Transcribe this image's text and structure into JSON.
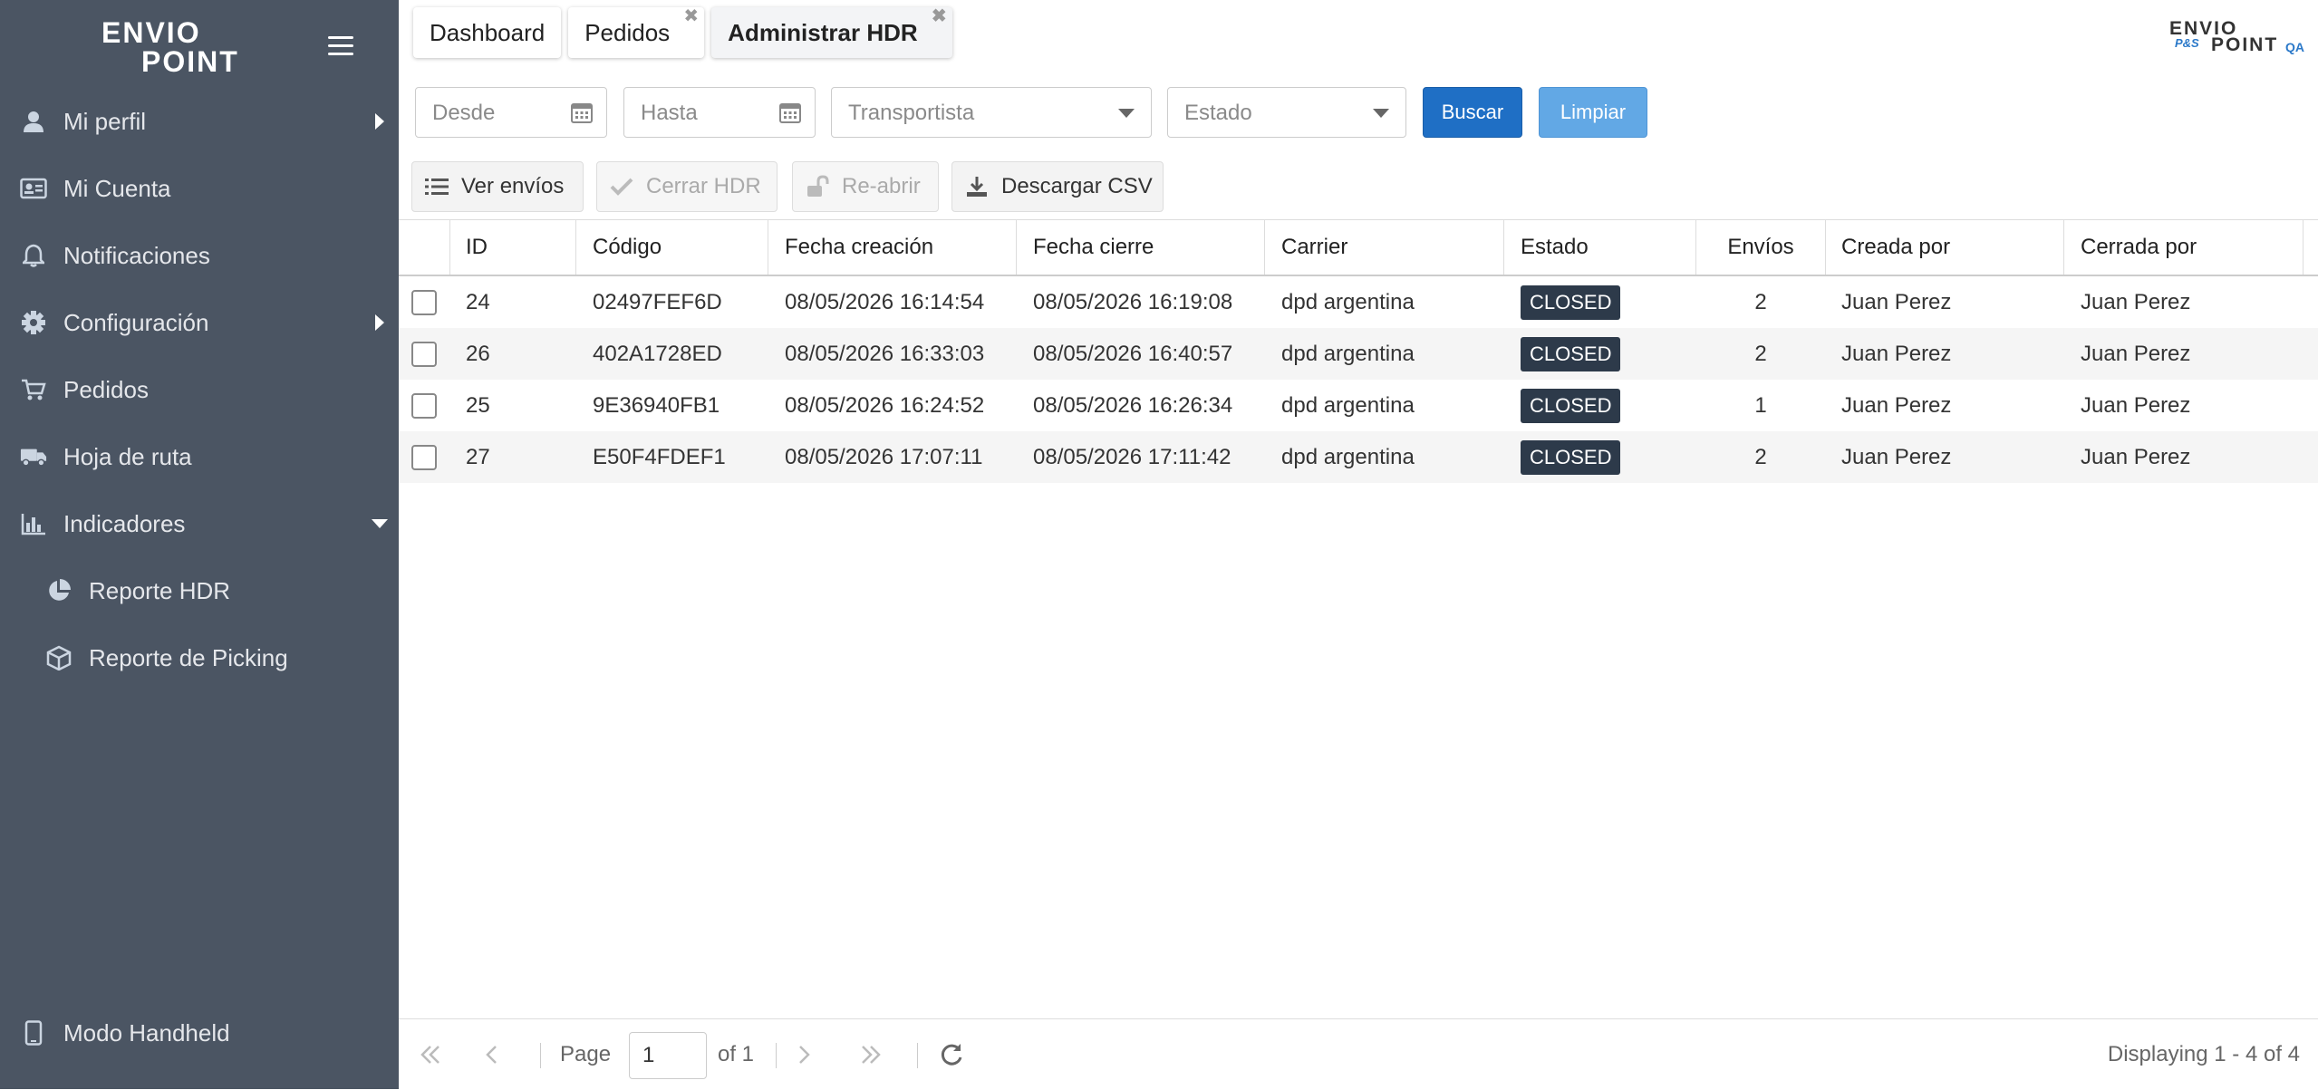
{
  "sidebar": {
    "brand_line1": "ENVIO",
    "brand_line2": "POINT",
    "items": [
      {
        "label": "Mi perfil",
        "icon": "user-icon"
      },
      {
        "label": "Mi Cuenta",
        "icon": "id-card-icon"
      },
      {
        "label": "Notificaciones",
        "icon": "bell-icon"
      },
      {
        "label": "Configuración",
        "icon": "gear-icon"
      },
      {
        "label": "Pedidos",
        "icon": "cart-icon"
      },
      {
        "label": "Hoja de ruta",
        "icon": "truck-icon"
      },
      {
        "label": "Indicadores",
        "icon": "bar-chart-icon"
      },
      {
        "label": "Reporte HDR",
        "icon": "pie-chart-icon"
      },
      {
        "label": "Reporte de Picking",
        "icon": "box-icon"
      }
    ],
    "footer_label": "Modo Handheld"
  },
  "tabs": [
    {
      "label": "Dashboard"
    },
    {
      "label": "Pedidos"
    },
    {
      "label": "Administrar HDR"
    }
  ],
  "logo_right": {
    "envio": "ENVIO",
    "pos": "P&S",
    "point": "POINT",
    "env": "QA"
  },
  "filters": {
    "desde_placeholder": "Desde",
    "hasta_placeholder": "Hasta",
    "transportista_placeholder": "Transportista",
    "estado_placeholder": "Estado",
    "buscar_label": "Buscar",
    "limpiar_label": "Limpiar"
  },
  "toolbar": {
    "ver_envios": "Ver envíos",
    "cerrar_hdr": "Cerrar HDR",
    "re_abrir": "Re-abrir",
    "descargar_csv": "Descargar CSV"
  },
  "table": {
    "headers": [
      "ID",
      "Código",
      "Fecha creación",
      "Fecha cierre",
      "Carrier",
      "Estado",
      "Envíos",
      "Creada por",
      "Cerrada por"
    ],
    "rows": [
      [
        "24",
        "02497FEF6D",
        "08/05/2026 16:14:54",
        "08/05/2026 16:19:08",
        "dpd argentina",
        "CLOSED",
        "2",
        "Juan Perez",
        "Juan Perez"
      ],
      [
        "26",
        "402A1728ED",
        "08/05/2026 16:33:03",
        "08/05/2026 16:40:57",
        "dpd argentina",
        "CLOSED",
        "2",
        "Juan Perez",
        "Juan Perez"
      ],
      [
        "25",
        "9E36940FB1",
        "08/05/2026 16:24:52",
        "08/05/2026 16:26:34",
        "dpd argentina",
        "CLOSED",
        "1",
        "Juan Perez",
        "Juan Perez"
      ],
      [
        "27",
        "E50F4FDEF1",
        "08/05/2026 17:07:11",
        "08/05/2026 17:11:42",
        "dpd argentina",
        "CLOSED",
        "2",
        "Juan Perez",
        "Juan Perez"
      ]
    ]
  },
  "pager": {
    "page_label": "Page",
    "page_value": "1",
    "of_label": "of 1",
    "displaying": "Displaying 1 - 4 of 4"
  },
  "colors": {
    "sidebar_bg": "#4b5563",
    "primary": "#1f6fc5",
    "primary_light": "#62a8e5",
    "badge_bg": "#2d3a4a"
  }
}
